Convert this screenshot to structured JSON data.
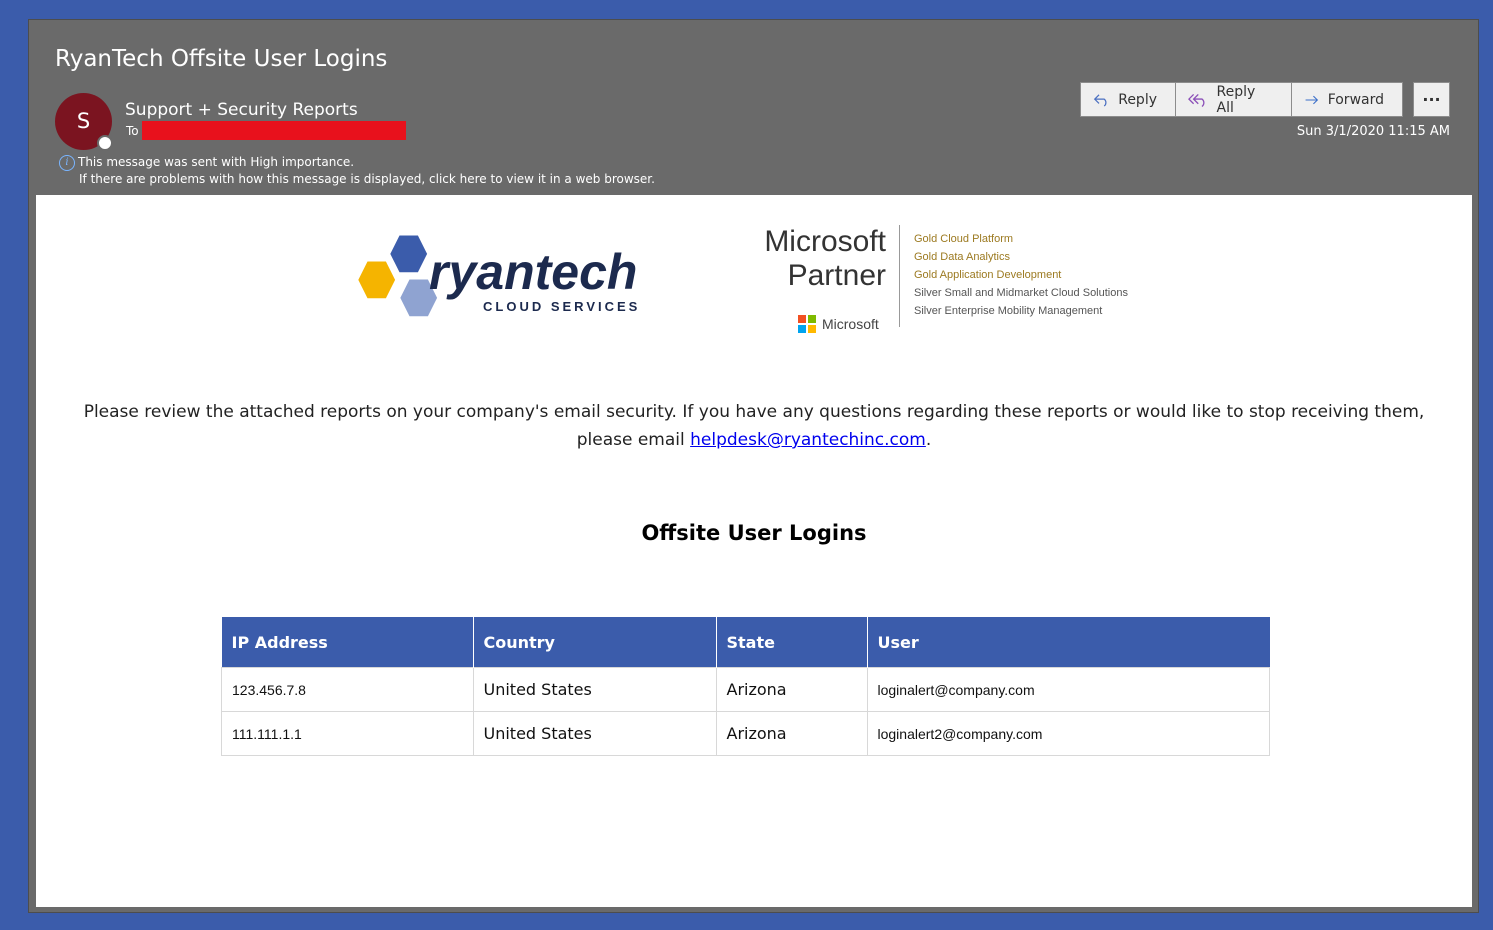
{
  "email": {
    "subject": "RyanTech Offsite User Logins",
    "avatar_initial": "S",
    "sender": "Support + Security Reports",
    "to_label": "To",
    "importance_notice": "This message was sent with High importance.",
    "display_notice": "If there are problems with how this message is displayed, click here to view it in a web browser.",
    "date": "Sun 3/1/2020 11:15 AM"
  },
  "actions": {
    "reply": "Reply",
    "reply_all": "Reply All",
    "forward": "Forward",
    "more": "···"
  },
  "logos": {
    "ryantech_wordmark": "ryantech",
    "ryantech_tagline": "CLOUD SERVICES",
    "ms_word": "Microsoft",
    "ms_partner": "Partner",
    "ms_small": "Microsoft",
    "competencies": [
      {
        "label": "Gold Cloud Platform",
        "tier": "gold"
      },
      {
        "label": "Gold Data Analytics",
        "tier": "gold"
      },
      {
        "label": "Gold Application Development",
        "tier": "gold"
      },
      {
        "label": "Silver Small and Midmarket Cloud Solutions",
        "tier": "silver"
      },
      {
        "label": "Silver Enterprise Mobility Management",
        "tier": "silver"
      }
    ]
  },
  "body": {
    "intro_line1": "Please review the attached reports on your company's email security. If you have any questions regarding these reports or would like to stop receiving them,",
    "intro_line2_prefix": "please email ",
    "helpdesk_email": "helpdesk@ryantechinc.com",
    "intro_line2_suffix": ".",
    "report_title": "Offsite User Logins"
  },
  "table": {
    "headers": [
      "IP Address",
      "Country",
      "State",
      "User"
    ],
    "rows": [
      [
        "123.456.7.8",
        "United States",
        "Arizona",
        "loginalert@company.com"
      ],
      [
        "111.111.1.1",
        "United States",
        "Arizona",
        "loginalert2@company.com"
      ]
    ]
  },
  "colors": {
    "accent_blue": "#3b5cab",
    "header_gray": "#6a6a6a",
    "avatar": "#7b1420",
    "redaction": "#e8111c"
  }
}
